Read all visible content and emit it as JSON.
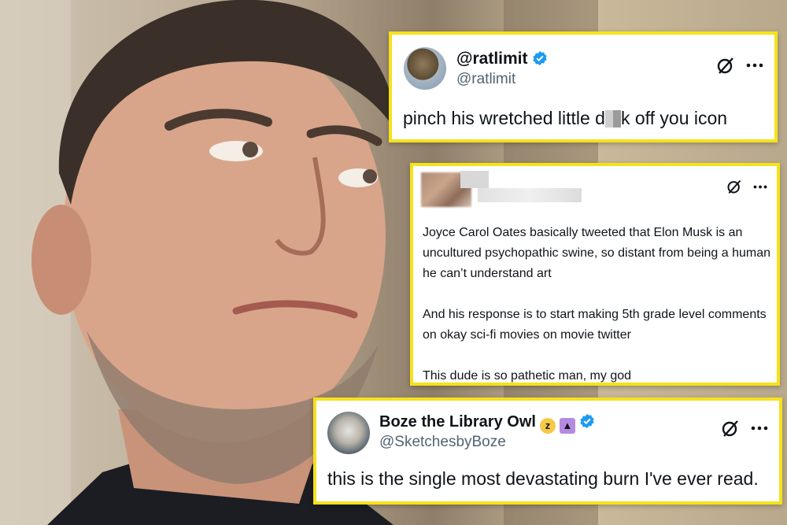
{
  "background": {
    "subject": "man looking up and to the side (photo)"
  },
  "tweets": [
    {
      "display_name": "@ratlimit",
      "handle": "@ratlimit",
      "verified": true,
      "text_before": "pinch his wretched little d",
      "text_after": "k off you icon"
    },
    {
      "display_name_redacted": true,
      "paragraphs": [
        "Joyce Carol Oates basically tweeted that Elon Musk is an uncultured psychopathic swine, so distant from being a human he can’t understand art",
        "And his response is to start making 5th grade level comments on okay sci-fi movies on movie twitter",
        "This dude is so pathetic man, my god"
      ]
    },
    {
      "display_name": "Boze the Library Owl",
      "handle": "@SketchesbyBoze",
      "verified": true,
      "emojis": [
        "sleeping-face-icon",
        "mage-icon"
      ],
      "text": "this is the single most devastating burn I've ever read."
    }
  ],
  "colors": {
    "highlight_border": "#f5e21a",
    "verified_blue": "#1d9bf0",
    "text": "#0f1419",
    "muted": "#536471"
  },
  "icons": {
    "grok": "grok-icon",
    "more": "more-options-icon",
    "verified": "verified-badge-icon"
  }
}
